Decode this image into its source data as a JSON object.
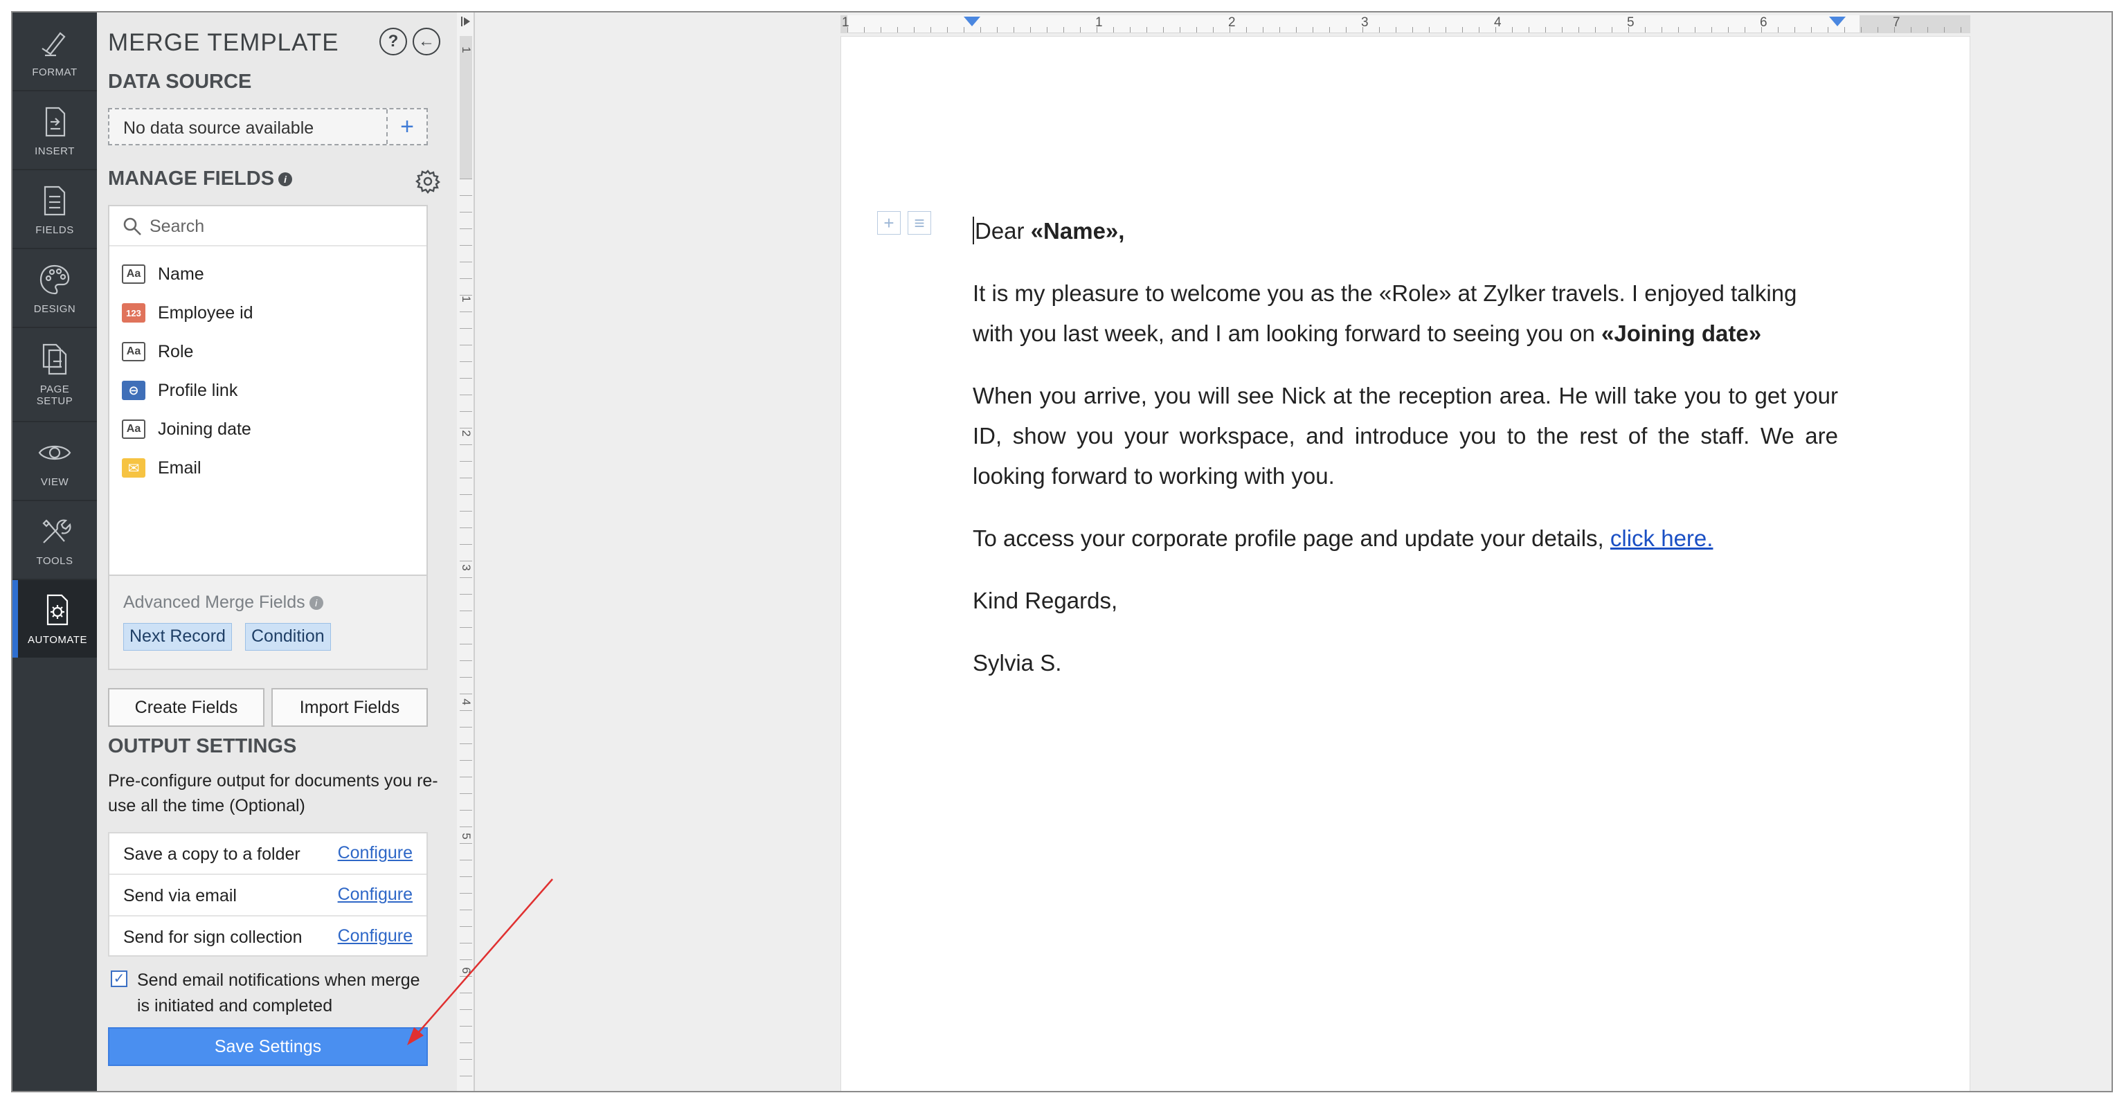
{
  "rail": {
    "items": [
      {
        "label": "FORMAT",
        "icon": "pen-icon"
      },
      {
        "label": "INSERT",
        "icon": "insert-icon"
      },
      {
        "label": "FIELDS",
        "icon": "fields-icon"
      },
      {
        "label": "DESIGN",
        "icon": "palette-icon"
      },
      {
        "label": "PAGE SETUP",
        "icon": "page-setup-icon"
      },
      {
        "label": "VIEW",
        "icon": "eye-icon"
      },
      {
        "label": "TOOLS",
        "icon": "tools-icon"
      },
      {
        "label": "AUTOMATE",
        "icon": "automate-icon",
        "active": true
      }
    ]
  },
  "panel": {
    "title": "MERGE TEMPLATE",
    "help_label": "?",
    "back_label": "←",
    "data_source": {
      "heading": "DATA SOURCE",
      "value": "No data source available",
      "add_label": "+"
    },
    "manage_fields": {
      "heading": "MANAGE FIELDS",
      "info_label": "i",
      "search_placeholder": "Search",
      "fields": [
        {
          "name": "Name",
          "type": "text",
          "badge": "Aa"
        },
        {
          "name": "Employee id",
          "type": "number",
          "badge": "123"
        },
        {
          "name": "Role",
          "type": "text",
          "badge": "Aa"
        },
        {
          "name": "Profile link",
          "type": "link",
          "badge": "⊖"
        },
        {
          "name": "Joining date",
          "type": "text",
          "badge": "Aa"
        },
        {
          "name": "Email",
          "type": "email",
          "badge": "✉"
        }
      ],
      "advanced": {
        "title": "Advanced Merge Fields",
        "info_label": "i",
        "chips": [
          "Next Record",
          "Condition"
        ]
      },
      "create_label": "Create Fields",
      "import_label": "Import Fields"
    },
    "output": {
      "heading": "OUTPUT SETTINGS",
      "description": "Pre-configure output for documents you re-use all the time (Optional)",
      "rows": [
        {
          "label": "Save a copy to a folder",
          "action": "Configure"
        },
        {
          "label": "Send via email",
          "action": "Configure"
        },
        {
          "label": "Send for sign collection",
          "action": "Configure"
        }
      ],
      "notify_checked": true,
      "notify_mark": "✓",
      "notify_label": "Send email notifications when merge is initiated and completed",
      "save_label": "Save Settings"
    }
  },
  "ruler": {
    "h_numbers": [
      "1",
      "1",
      "2",
      "3",
      "4",
      "5",
      "6",
      "7"
    ],
    "v_numbers": [
      "1",
      "1",
      "2",
      "3",
      "4",
      "5",
      "6"
    ]
  },
  "document": {
    "greeting_prefix": "Dear ",
    "greeting_field": "«Name»,",
    "p1_text": "It is my pleasure to welcome you as the «Role» at Zylker travels. I enjoyed talking with you last week, and I am looking forward to seeing you on ",
    "p1_field": "«Joining date»",
    "p2": "When you arrive, you will see Nick at the reception area. He will take you to get your ID, show you your workspace, and introduce you to the rest of the staff. We are looking forward to working with you.",
    "p3_text": "To access your corporate profile page and update your details, ",
    "p3_link": "click here.",
    "closing": "Kind Regards,",
    "signature": "Sylvia S.",
    "insert_icon_label": "+",
    "para_icon_label": "≡"
  },
  "colors": {
    "rail_bg": "#33383d",
    "accent_blue": "#4a8ff0",
    "link_blue": "#1a4fc4",
    "annotation_red": "#e03030"
  }
}
